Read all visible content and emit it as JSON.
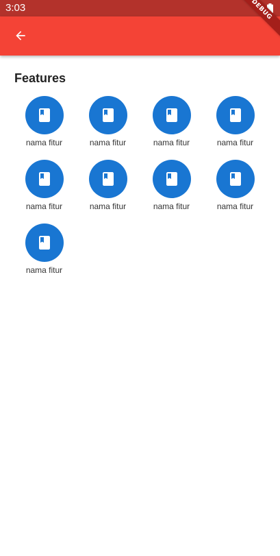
{
  "status_bar": {
    "time": "3:03",
    "battery_icon": "battery-full-icon"
  },
  "app_bar": {
    "back_icon": "arrow-back-icon",
    "color": "#f44336"
  },
  "debug_banner": {
    "label": "DEBUG"
  },
  "features": {
    "title": "Features",
    "icon": "book-icon",
    "icon_color": "#1976d2",
    "items": [
      {
        "label": "nama fitur"
      },
      {
        "label": "nama fitur"
      },
      {
        "label": "nama fitur"
      },
      {
        "label": "nama fitur"
      },
      {
        "label": "nama fitur"
      },
      {
        "label": "nama fitur"
      },
      {
        "label": "nama fitur"
      },
      {
        "label": "nama fitur"
      },
      {
        "label": "nama fitur"
      }
    ]
  }
}
